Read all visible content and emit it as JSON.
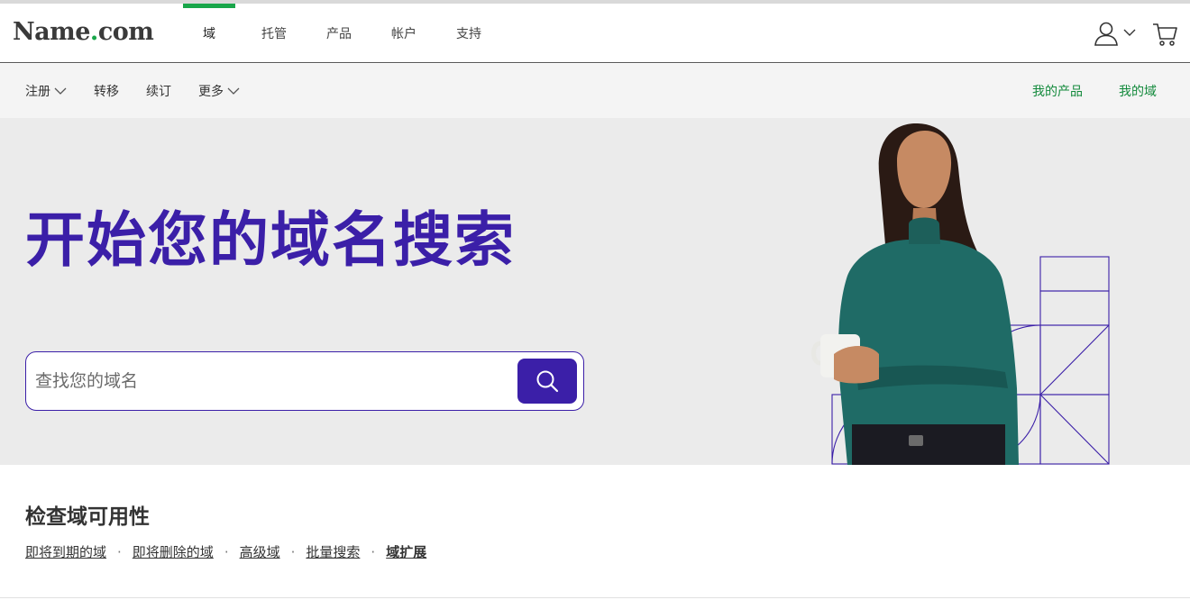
{
  "header": {
    "logo_main": "Name",
    "logo_dot": ".",
    "logo_tld": "com",
    "nav": [
      {
        "label": "域",
        "active": true
      },
      {
        "label": "托管",
        "active": false
      },
      {
        "label": "产品",
        "active": false
      },
      {
        "label": "帐户",
        "active": false
      },
      {
        "label": "支持",
        "active": false
      }
    ],
    "icons": [
      "user-icon",
      "chevron-down-icon",
      "cart-icon"
    ]
  },
  "subnav": {
    "left": [
      {
        "label": "注册",
        "dropdown": true
      },
      {
        "label": "转移",
        "dropdown": false
      },
      {
        "label": "续订",
        "dropdown": false
      },
      {
        "label": "更多",
        "dropdown": true
      }
    ],
    "right": [
      {
        "label": "我的产品"
      },
      {
        "label": "我的域"
      }
    ]
  },
  "hero": {
    "title": "开始您的域名搜索",
    "search_placeholder": "查找您的域名",
    "search_icon": "search-icon"
  },
  "availability": {
    "title": "检查域可用性",
    "links": [
      {
        "label": "即将到期的域"
      },
      {
        "label": "即将删除的域"
      },
      {
        "label": "高级域"
      },
      {
        "label": "批量搜索"
      },
      {
        "label": "域扩展"
      }
    ],
    "separator": "·"
  },
  "colors": {
    "brand_purple": "#3b1fa8",
    "brand_green": "#19a64a",
    "link_green": "#138a3c",
    "hero_bg": "#ebebeb",
    "subnav_bg": "#f4f4f4"
  }
}
